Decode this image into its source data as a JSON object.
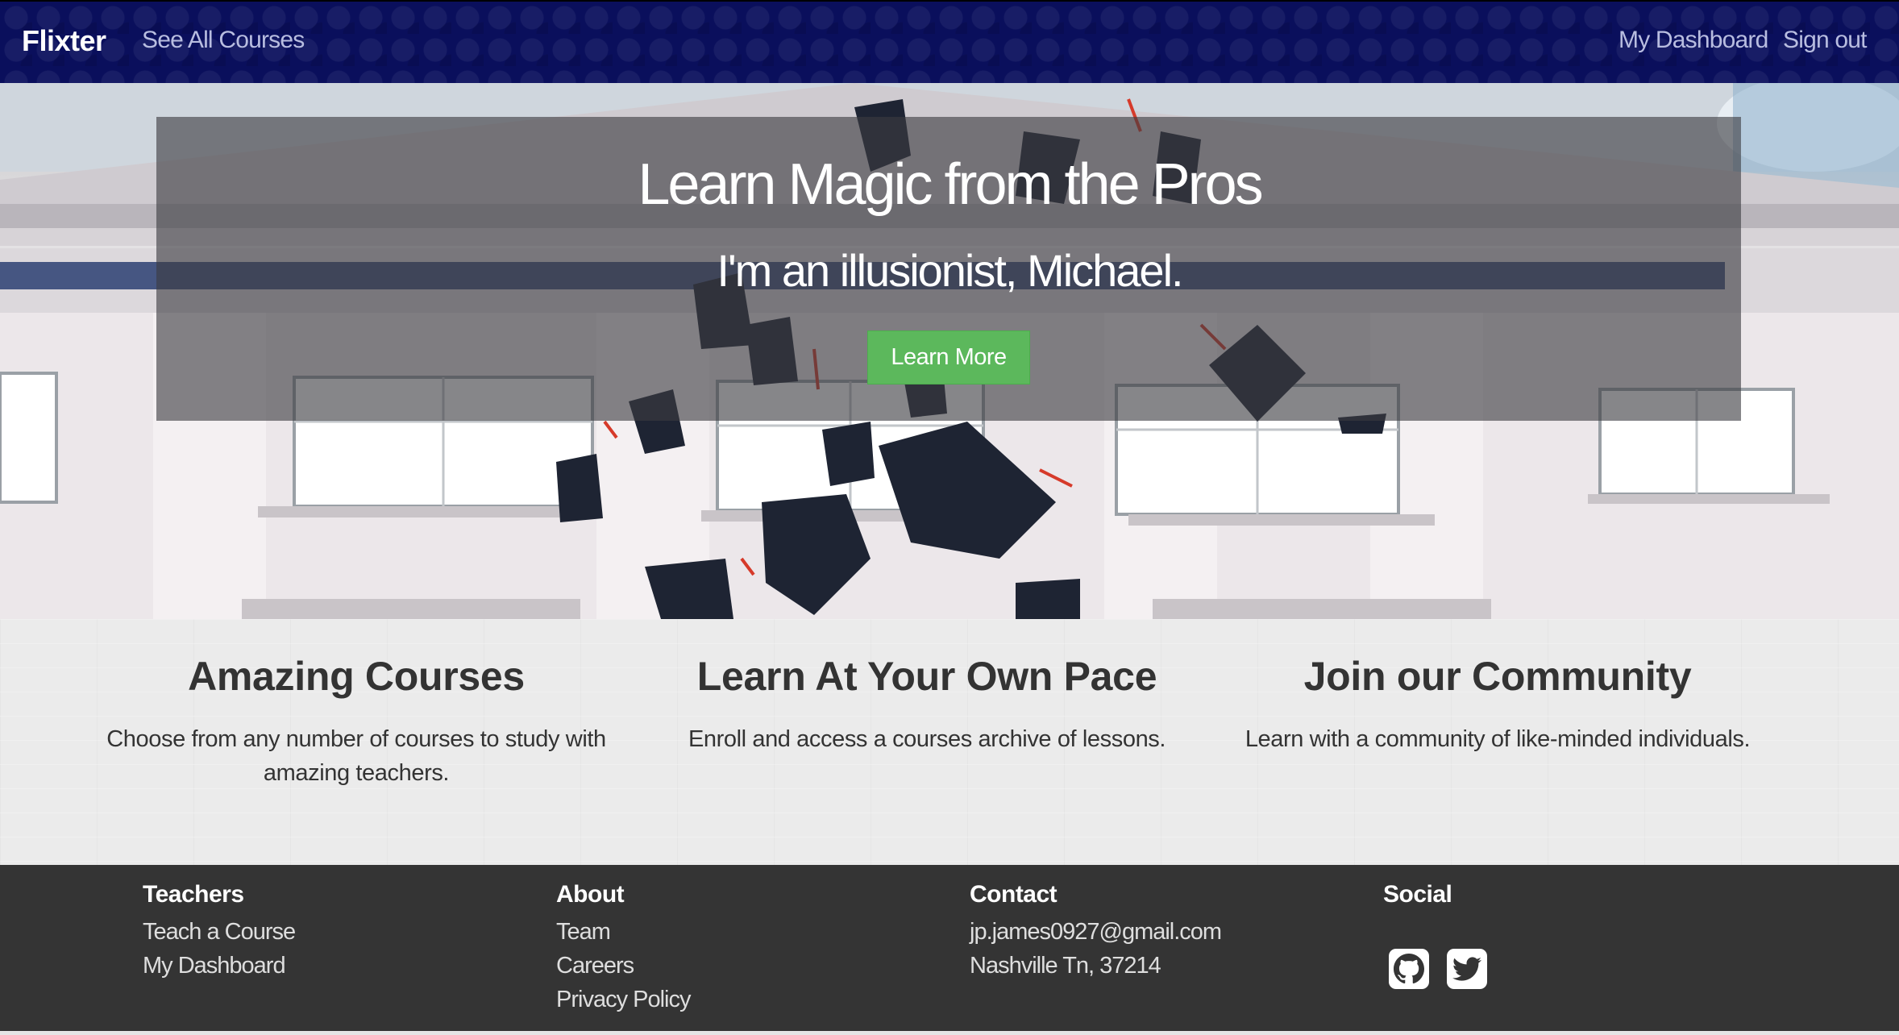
{
  "nav": {
    "brand": "Flixter",
    "all_courses": "See All Courses",
    "dashboard": "My Dashboard",
    "sign_out": "Sign out"
  },
  "hero": {
    "title": "Learn Magic from the Pros",
    "subtitle": "I'm an illusionist, Michael.",
    "button": "Learn More",
    "button_color": "#5cb85c"
  },
  "features": [
    {
      "title": "Amazing Courses",
      "text": "Choose from any number of courses to study with amazing teachers."
    },
    {
      "title": "Learn At Your Own Pace",
      "text": "Enroll and access a courses archive of lessons."
    },
    {
      "title": "Join our Community",
      "text": "Learn with a community of like-minded individuals."
    }
  ],
  "footer": {
    "teachers": {
      "heading": "Teachers",
      "links": [
        "Teach a Course",
        "My Dashboard"
      ]
    },
    "about": {
      "heading": "About",
      "links": [
        "Team",
        "Careers",
        "Privacy Policy"
      ]
    },
    "contact": {
      "heading": "Contact",
      "email": "jp.james0927@gmail.com",
      "address": "Nashville Tn, 37214"
    },
    "social": {
      "heading": "Social",
      "icons": [
        "github-icon",
        "twitter-icon"
      ]
    }
  },
  "colors": {
    "navbar": "#0a0f5c",
    "footer": "#343434",
    "accent": "#5cb85c"
  }
}
